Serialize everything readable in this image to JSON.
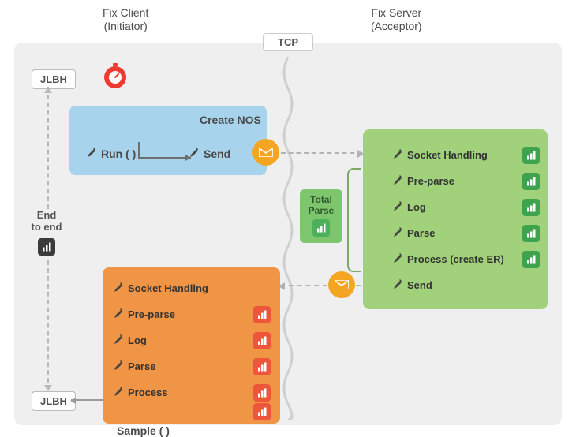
{
  "headers": {
    "client_title": "Fix Client",
    "client_sub": "(Initiator)",
    "server_title": "Fix Server",
    "server_sub": "(Acceptor)"
  },
  "tcp_label": "TCP",
  "jlbh": {
    "top": "JLBH",
    "bottom": "JLBH"
  },
  "endToEnd": {
    "line1": "End",
    "line2": "to end"
  },
  "blue": {
    "run": "Run ( )",
    "create_nos": "Create NOS",
    "send": "Send"
  },
  "orange": {
    "sample": "Sample ( )",
    "steps": [
      "Socket Handling",
      "Pre-parse",
      "Log",
      "Parse",
      "Process"
    ]
  },
  "green": {
    "totalParse": {
      "l1": "Total",
      "l2": "Parse"
    },
    "steps": [
      "Socket Handling",
      "Pre-parse",
      "Log",
      "Parse",
      "Process (create ER)",
      "Send"
    ]
  },
  "icons": {
    "stopwatch": "stopwatch-icon",
    "eyedropper": "eyedropper-icon",
    "envelope": "envelope-icon",
    "barchart": "barchart-icon"
  },
  "colors": {
    "bg": "#efefef",
    "blue": "#a8d3ec",
    "orange": "#ef9545",
    "green": "#a1d27b",
    "greenDark": "#7ec66e",
    "red": "#ed563a",
    "amber": "#f4a623",
    "stopwatchRed": "#ee3a30"
  }
}
